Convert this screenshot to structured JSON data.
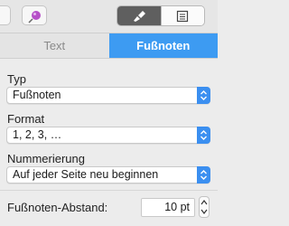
{
  "tabs": [
    {
      "label": "Text",
      "active": false
    },
    {
      "label": "Fußnoten",
      "active": true
    }
  ],
  "fields": {
    "typ": {
      "label": "Typ",
      "value": "Fußnoten"
    },
    "format": {
      "label": "Format",
      "value": "1, 2, 3, …"
    },
    "nummerierung": {
      "label": "Nummerierung",
      "value": "Auf jeder Seite neu beginnen"
    },
    "abstand": {
      "label": "Fußnoten-Abstand:",
      "value": "10 pt"
    }
  },
  "colors": {
    "accent": "#3d9bf2",
    "select_arrow": "#3b8ff0"
  },
  "icons": [
    "pin-icon",
    "format-brush-icon",
    "document-icon",
    "chevron-updown-icon",
    "stepper-arrows-icon"
  ]
}
